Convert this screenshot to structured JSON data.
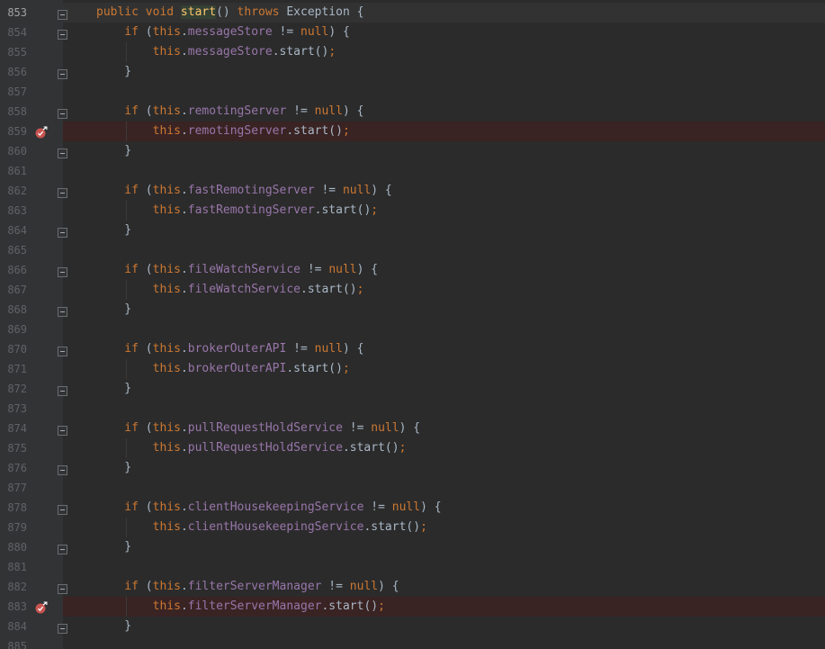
{
  "editor": {
    "current_line": 853,
    "colors": {
      "background": "#2b2b2b",
      "gutter": "#313335",
      "keyword": "#cc7832",
      "field": "#9876aa",
      "method_declaration": "#ffc66d",
      "plain": "#a9b7c6",
      "line_number": "#606366",
      "breakpoint_line": "#3a2323",
      "breakpoint_icon": "#c75450"
    },
    "lines": [
      {
        "number": "853",
        "fold": "minus-top",
        "tokens": [
          {
            "t": "public void ",
            "c": "kw"
          },
          {
            "t": "start",
            "c": "mth-decl"
          },
          {
            "t": "() ",
            "c": "plain"
          },
          {
            "t": "throws ",
            "c": "kw"
          },
          {
            "t": "Exception {",
            "c": "plain"
          }
        ]
      },
      {
        "number": "854",
        "fold": "minus-top",
        "tokens": [
          {
            "t": "    if ",
            "c": "kw"
          },
          {
            "t": "(",
            "c": "plain"
          },
          {
            "t": "this",
            "c": "kw"
          },
          {
            "t": ".",
            "c": "plain"
          },
          {
            "t": "messageStore",
            "c": "fld"
          },
          {
            "t": " != ",
            "c": "plain"
          },
          {
            "t": "null",
            "c": "kw"
          },
          {
            "t": ") {",
            "c": "plain"
          }
        ]
      },
      {
        "number": "855",
        "tokens": [
          {
            "t": "        ",
            "c": "plain"
          },
          {
            "t": "this",
            "c": "kw"
          },
          {
            "t": ".",
            "c": "plain"
          },
          {
            "t": "messageStore",
            "c": "fld"
          },
          {
            "t": ".start()",
            "c": "plain"
          },
          {
            "t": ";",
            "c": "kw"
          }
        ]
      },
      {
        "number": "856",
        "fold": "minus-bottom",
        "tokens": [
          {
            "t": "    }",
            "c": "plain"
          }
        ]
      },
      {
        "number": "857",
        "tokens": []
      },
      {
        "number": "858",
        "fold": "minus-top",
        "tokens": [
          {
            "t": "    if ",
            "c": "kw"
          },
          {
            "t": "(",
            "c": "plain"
          },
          {
            "t": "this",
            "c": "kw"
          },
          {
            "t": ".",
            "c": "plain"
          },
          {
            "t": "remotingServer",
            "c": "fld"
          },
          {
            "t": " != ",
            "c": "plain"
          },
          {
            "t": "null",
            "c": "kw"
          },
          {
            "t": ") {",
            "c": "plain"
          }
        ]
      },
      {
        "number": "859",
        "breakpoint": true,
        "tokens": [
          {
            "t": "        ",
            "c": "plain"
          },
          {
            "t": "this",
            "c": "kw"
          },
          {
            "t": ".",
            "c": "plain"
          },
          {
            "t": "remotingServer",
            "c": "fld"
          },
          {
            "t": ".start()",
            "c": "plain"
          },
          {
            "t": ";",
            "c": "kw"
          }
        ]
      },
      {
        "number": "860",
        "fold": "minus-bottom",
        "tokens": [
          {
            "t": "    }",
            "c": "plain"
          }
        ]
      },
      {
        "number": "861",
        "tokens": []
      },
      {
        "number": "862",
        "fold": "minus-top",
        "tokens": [
          {
            "t": "    if ",
            "c": "kw"
          },
          {
            "t": "(",
            "c": "plain"
          },
          {
            "t": "this",
            "c": "kw"
          },
          {
            "t": ".",
            "c": "plain"
          },
          {
            "t": "fastRemotingServer",
            "c": "fld"
          },
          {
            "t": " != ",
            "c": "plain"
          },
          {
            "t": "null",
            "c": "kw"
          },
          {
            "t": ") {",
            "c": "plain"
          }
        ]
      },
      {
        "number": "863",
        "tokens": [
          {
            "t": "        ",
            "c": "plain"
          },
          {
            "t": "this",
            "c": "kw"
          },
          {
            "t": ".",
            "c": "plain"
          },
          {
            "t": "fastRemotingServer",
            "c": "fld"
          },
          {
            "t": ".start()",
            "c": "plain"
          },
          {
            "t": ";",
            "c": "kw"
          }
        ]
      },
      {
        "number": "864",
        "fold": "minus-bottom",
        "tokens": [
          {
            "t": "    }",
            "c": "plain"
          }
        ]
      },
      {
        "number": "865",
        "tokens": []
      },
      {
        "number": "866",
        "fold": "minus-top",
        "tokens": [
          {
            "t": "    if ",
            "c": "kw"
          },
          {
            "t": "(",
            "c": "plain"
          },
          {
            "t": "this",
            "c": "kw"
          },
          {
            "t": ".",
            "c": "plain"
          },
          {
            "t": "fileWatchService",
            "c": "fld"
          },
          {
            "t": " != ",
            "c": "plain"
          },
          {
            "t": "null",
            "c": "kw"
          },
          {
            "t": ") {",
            "c": "plain"
          }
        ]
      },
      {
        "number": "867",
        "tokens": [
          {
            "t": "        ",
            "c": "plain"
          },
          {
            "t": "this",
            "c": "kw"
          },
          {
            "t": ".",
            "c": "plain"
          },
          {
            "t": "fileWatchService",
            "c": "fld"
          },
          {
            "t": ".start()",
            "c": "plain"
          },
          {
            "t": ";",
            "c": "kw"
          }
        ]
      },
      {
        "number": "868",
        "fold": "minus-bottom",
        "tokens": [
          {
            "t": "    }",
            "c": "plain"
          }
        ]
      },
      {
        "number": "869",
        "tokens": []
      },
      {
        "number": "870",
        "fold": "minus-top",
        "tokens": [
          {
            "t": "    if ",
            "c": "kw"
          },
          {
            "t": "(",
            "c": "plain"
          },
          {
            "t": "this",
            "c": "kw"
          },
          {
            "t": ".",
            "c": "plain"
          },
          {
            "t": "brokerOuterAPI",
            "c": "fld"
          },
          {
            "t": " != ",
            "c": "plain"
          },
          {
            "t": "null",
            "c": "kw"
          },
          {
            "t": ") {",
            "c": "plain"
          }
        ]
      },
      {
        "number": "871",
        "tokens": [
          {
            "t": "        ",
            "c": "plain"
          },
          {
            "t": "this",
            "c": "kw"
          },
          {
            "t": ".",
            "c": "plain"
          },
          {
            "t": "brokerOuterAPI",
            "c": "fld"
          },
          {
            "t": ".start()",
            "c": "plain"
          },
          {
            "t": ";",
            "c": "kw"
          }
        ]
      },
      {
        "number": "872",
        "fold": "minus-bottom",
        "tokens": [
          {
            "t": "    }",
            "c": "plain"
          }
        ]
      },
      {
        "number": "873",
        "tokens": []
      },
      {
        "number": "874",
        "fold": "minus-top",
        "tokens": [
          {
            "t": "    if ",
            "c": "kw"
          },
          {
            "t": "(",
            "c": "plain"
          },
          {
            "t": "this",
            "c": "kw"
          },
          {
            "t": ".",
            "c": "plain"
          },
          {
            "t": "pullRequestHoldService",
            "c": "fld"
          },
          {
            "t": " != ",
            "c": "plain"
          },
          {
            "t": "null",
            "c": "kw"
          },
          {
            "t": ") {",
            "c": "plain"
          }
        ]
      },
      {
        "number": "875",
        "tokens": [
          {
            "t": "        ",
            "c": "plain"
          },
          {
            "t": "this",
            "c": "kw"
          },
          {
            "t": ".",
            "c": "plain"
          },
          {
            "t": "pullRequestHoldService",
            "c": "fld"
          },
          {
            "t": ".start()",
            "c": "plain"
          },
          {
            "t": ";",
            "c": "kw"
          }
        ]
      },
      {
        "number": "876",
        "fold": "minus-bottom",
        "tokens": [
          {
            "t": "    }",
            "c": "plain"
          }
        ]
      },
      {
        "number": "877",
        "tokens": []
      },
      {
        "number": "878",
        "fold": "minus-top",
        "tokens": [
          {
            "t": "    if ",
            "c": "kw"
          },
          {
            "t": "(",
            "c": "plain"
          },
          {
            "t": "this",
            "c": "kw"
          },
          {
            "t": ".",
            "c": "plain"
          },
          {
            "t": "clientHousekeepingService",
            "c": "fld"
          },
          {
            "t": " != ",
            "c": "plain"
          },
          {
            "t": "null",
            "c": "kw"
          },
          {
            "t": ") {",
            "c": "plain"
          }
        ]
      },
      {
        "number": "879",
        "tokens": [
          {
            "t": "        ",
            "c": "plain"
          },
          {
            "t": "this",
            "c": "kw"
          },
          {
            "t": ".",
            "c": "plain"
          },
          {
            "t": "clientHousekeepingService",
            "c": "fld"
          },
          {
            "t": ".start()",
            "c": "plain"
          },
          {
            "t": ";",
            "c": "kw"
          }
        ]
      },
      {
        "number": "880",
        "fold": "minus-bottom",
        "tokens": [
          {
            "t": "    }",
            "c": "plain"
          }
        ]
      },
      {
        "number": "881",
        "tokens": []
      },
      {
        "number": "882",
        "fold": "minus-top",
        "tokens": [
          {
            "t": "    if ",
            "c": "kw"
          },
          {
            "t": "(",
            "c": "plain"
          },
          {
            "t": "this",
            "c": "kw"
          },
          {
            "t": ".",
            "c": "plain"
          },
          {
            "t": "filterServerManager",
            "c": "fld"
          },
          {
            "t": " != ",
            "c": "plain"
          },
          {
            "t": "null",
            "c": "kw"
          },
          {
            "t": ") {",
            "c": "plain"
          }
        ]
      },
      {
        "number": "883",
        "breakpoint": true,
        "tokens": [
          {
            "t": "        ",
            "c": "plain"
          },
          {
            "t": "this",
            "c": "kw"
          },
          {
            "t": ".",
            "c": "plain"
          },
          {
            "t": "filterServerManager",
            "c": "fld"
          },
          {
            "t": ".start()",
            "c": "plain"
          },
          {
            "t": ";",
            "c": "kw"
          }
        ]
      },
      {
        "number": "884",
        "fold": "minus-bottom",
        "tokens": [
          {
            "t": "    }",
            "c": "plain"
          }
        ]
      },
      {
        "number": "885",
        "tokens": []
      }
    ]
  }
}
